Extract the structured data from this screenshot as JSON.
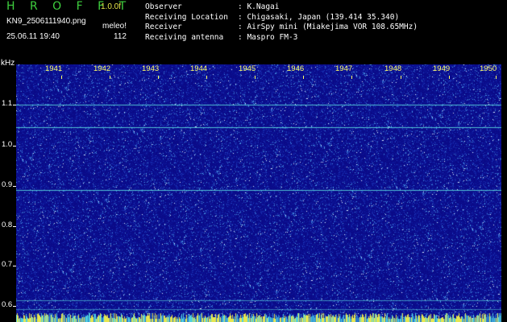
{
  "header": {
    "brand": "H R O F F T",
    "version": "1.0.0f",
    "file_name": "KN9_2506111940.png",
    "meleo": "meleo!",
    "timestamp": "25.06.11 19:40",
    "count": "112"
  },
  "meta": [
    {
      "key": "Observer",
      "value": ": K.Nagai"
    },
    {
      "key": "Receiving Location",
      "value": ": Chigasaki, Japan (139.414 35.340)"
    },
    {
      "key": "Receiver",
      "value": ": AirSpy mini (Miakejima VOR 108.65MHz)"
    },
    {
      "key": "Receiving antenna",
      "value": ": Maspro FM-3"
    }
  ],
  "spectrogram": {
    "y_unit": "kHz",
    "y_ticks": [
      "1.1",
      "1.0",
      "0.9",
      "0.8",
      "0.7",
      "0.6"
    ],
    "x_ticks": [
      "1941",
      "1942",
      "1943",
      "1944",
      "1945",
      "1946",
      "1947",
      "1948",
      "1949",
      "1950"
    ],
    "background_color": "#0a0a88",
    "signal_color": "#5de0e0",
    "signal_lines_khz": [
      1.1,
      1.045,
      0.888,
      0.615
    ]
  }
}
